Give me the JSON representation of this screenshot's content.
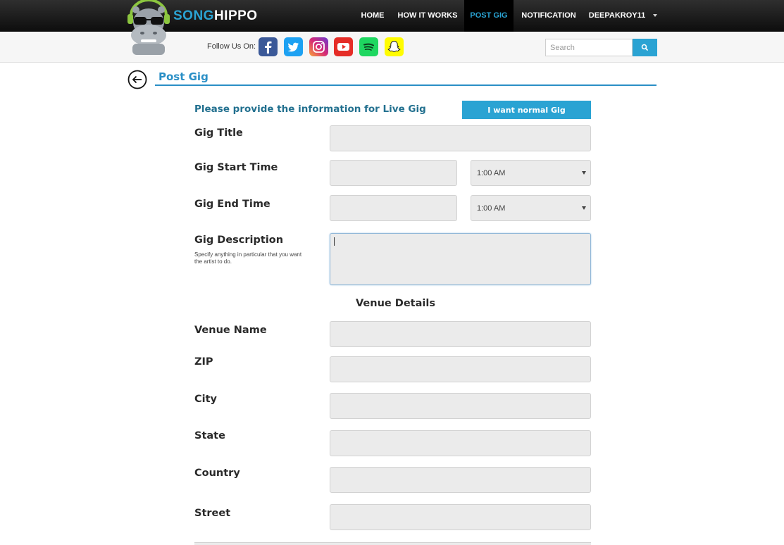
{
  "brand": {
    "part1": "SONG",
    "part2": "HIPPO"
  },
  "nav": {
    "items": [
      "HOME",
      "HOW IT WORKS",
      "POST GIG",
      "NOTIFICATION",
      "DEEPAKROY11"
    ],
    "active": "POST GIG"
  },
  "social": {
    "follow_label": "Follow Us On:",
    "icons": [
      "facebook-icon",
      "twitter-icon",
      "instagram-icon",
      "youtube-icon",
      "spotify-icon",
      "snapchat-icon"
    ]
  },
  "search": {
    "placeholder": "Search"
  },
  "page": {
    "title": "Post Gig",
    "info": "Please provide the information for Live Gig",
    "normal_gig_button": "I want normal Gig"
  },
  "form": {
    "gig_title": "Gig Title",
    "gig_start_time": "Gig Start Time",
    "gig_end_time": "Gig End Time",
    "start_time_value": "1:00 AM",
    "end_time_value": "1:00 AM",
    "gig_description": "Gig Description",
    "gig_description_hint": "Specify anything in particular that you want the artist to do."
  },
  "venue": {
    "section_title": "Venue Details",
    "venue_name": "Venue Name",
    "zip": "ZIP",
    "city": "City",
    "state": "State",
    "country": "Country",
    "street": "Street"
  },
  "colors": {
    "accent": "#2aa3d3",
    "title_blue": "#2a8fc6",
    "field_bg": "#ebebeb"
  }
}
